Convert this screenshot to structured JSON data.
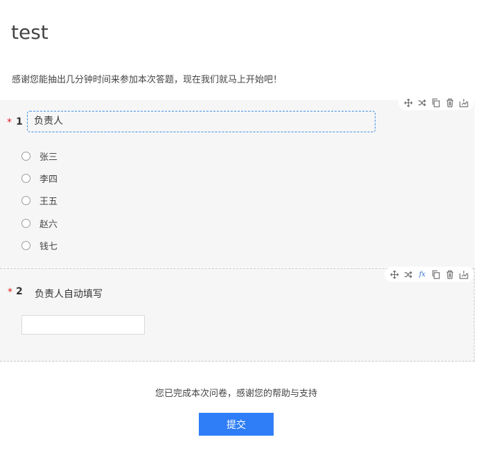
{
  "survey": {
    "title": "test",
    "intro": "感谢您能抽出几分钟时间来参加本次答题，现在我们就马上开始吧！"
  },
  "questions": [
    {
      "number": "1",
      "required_mark": "*",
      "title": "负责人",
      "options": [
        "张三",
        "李四",
        "王五",
        "赵六",
        "钱七"
      ]
    },
    {
      "number": "2",
      "required_mark": "*",
      "title": "负责人自动填写",
      "input_value": ""
    }
  ],
  "toolbar_icons": [
    "move-icon",
    "shuffle-icon",
    "fx-icon",
    "copy-icon",
    "delete-icon",
    "export-icon"
  ],
  "toolbar_fx_label": "fx",
  "footer": {
    "complete_text": "您已完成本次问卷，感谢您的帮助与支持",
    "submit_label": "提交"
  },
  "colors": {
    "accent": "#2f7ef7",
    "required": "#e02020",
    "focus_border": "#3a8ee6",
    "question_bg": "#f6f6f6"
  }
}
